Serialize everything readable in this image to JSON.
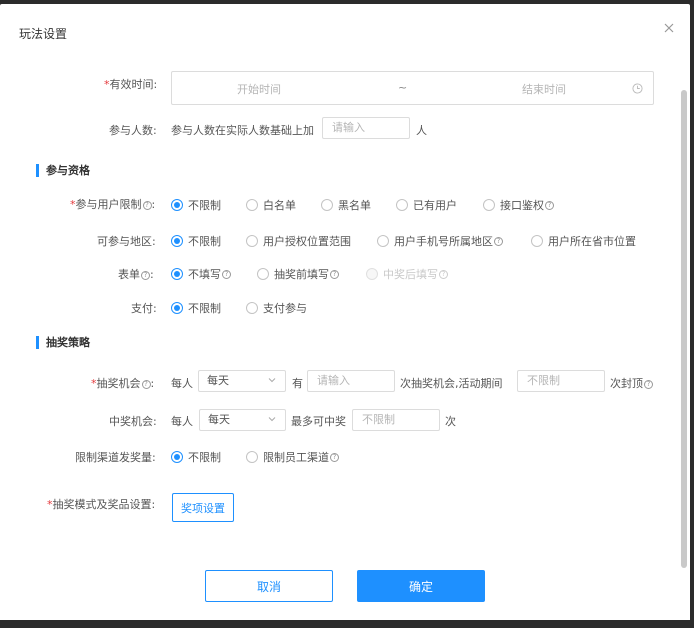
{
  "dialog": {
    "title": "玩法设置",
    "close_icon": "close-icon"
  },
  "valid_time": {
    "required_mark": "*",
    "label": "有效时间:",
    "start_placeholder": "开始时间",
    "separator": "~",
    "end_placeholder": "结束时间",
    "icon": "clock-icon"
  },
  "participants": {
    "label": "参与人数:",
    "prefix": "参与人数在实际人数基础上加",
    "input_placeholder": "请输入",
    "unit": "人"
  },
  "section_eligibility": {
    "title": "参与资格"
  },
  "user_limit": {
    "required_mark": "*",
    "label": "参与用户限制",
    "colon": ":",
    "options": [
      "不限制",
      "白名单",
      "黑名单",
      "已有用户",
      "接口鉴权"
    ],
    "selected": "不限制"
  },
  "region": {
    "label": "可参与地区:",
    "options": [
      "不限制",
      "用户授权位置范围",
      "用户手机号所属地区",
      "用户所在省市位置"
    ],
    "selected": "不限制"
  },
  "form": {
    "label": "表单",
    "colon": ":",
    "options": [
      "不填写",
      "抽奖前填写",
      "中奖后填写"
    ],
    "selected": "不填写",
    "disabled": "中奖后填写"
  },
  "payment": {
    "label": "支付:",
    "options": [
      "不限制",
      "支付参与"
    ],
    "selected": "不限制"
  },
  "section_strategy": {
    "title": "抽奖策略"
  },
  "draw_chance": {
    "required_mark": "*",
    "label": "抽奖机会",
    "colon": ":",
    "per_person": "每人",
    "period_value": "每天",
    "has": "有",
    "count_placeholder": "请输入",
    "middle_text": "次抽奖机会,活动期间",
    "cap_placeholder": "不限制",
    "suffix": "次封顶"
  },
  "win_chance": {
    "label": "中奖机会:",
    "per_person": "每人",
    "period_value": "每天",
    "max_text": "最多可中奖",
    "max_placeholder": "不限制",
    "unit": "次"
  },
  "channel_limit": {
    "label": "限制渠道发奖量:",
    "options": [
      "不限制",
      "限制员工渠道"
    ],
    "selected": "不限制"
  },
  "prize_mode": {
    "required_mark": "*",
    "label": "抽奖模式及奖品设置:",
    "button_label": "奖项设置"
  },
  "footer": {
    "cancel_label": "取消",
    "confirm_label": "确定"
  },
  "colors": {
    "accent": "#1e90ff",
    "required": "#e4393c"
  }
}
